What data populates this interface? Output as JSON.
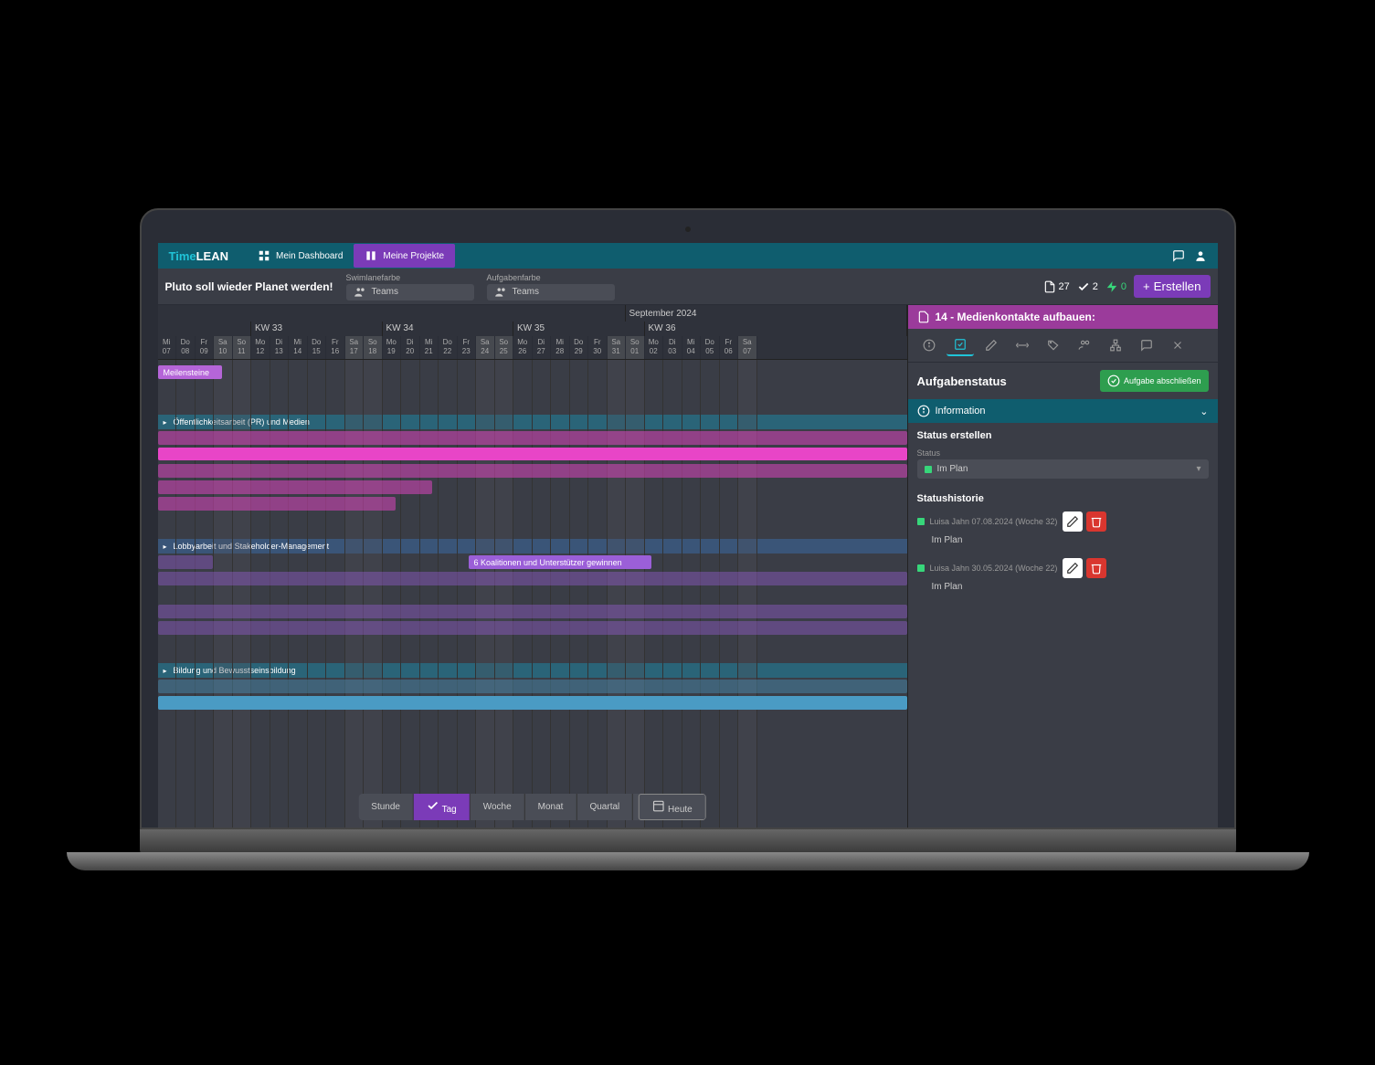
{
  "brand": {
    "part1": "Time",
    "part2": "LEAN"
  },
  "nav": {
    "dashboard": "Mein Dashboard",
    "projects": "Meine Projekte"
  },
  "project_title": "Pluto soll wieder Planet werden!",
  "swimlane": {
    "label": "Swimlanefarbe",
    "value": "Teams"
  },
  "taskcolor": {
    "label": "Aufgabenfarbe",
    "value": "Teams"
  },
  "stats": {
    "files": "27",
    "checks": "2",
    "bolt": "0"
  },
  "btn_create": "Erstellen",
  "month": "September 2024",
  "weeks": [
    "KW 33",
    "KW 34",
    "KW 35",
    "KW 36"
  ],
  "days": [
    {
      "d": "Mi",
      "n": "07"
    },
    {
      "d": "Do",
      "n": "08"
    },
    {
      "d": "Fr",
      "n": "09"
    },
    {
      "d": "Sa",
      "n": "10",
      "we": true
    },
    {
      "d": "So",
      "n": "11",
      "we": true
    },
    {
      "d": "Mo",
      "n": "12"
    },
    {
      "d": "Di",
      "n": "13"
    },
    {
      "d": "Mi",
      "n": "14"
    },
    {
      "d": "Do",
      "n": "15"
    },
    {
      "d": "Fr",
      "n": "16"
    },
    {
      "d": "Sa",
      "n": "17",
      "we": true
    },
    {
      "d": "So",
      "n": "18",
      "we": true
    },
    {
      "d": "Mo",
      "n": "19"
    },
    {
      "d": "Di",
      "n": "20"
    },
    {
      "d": "Mi",
      "n": "21"
    },
    {
      "d": "Do",
      "n": "22"
    },
    {
      "d": "Fr",
      "n": "23"
    },
    {
      "d": "Sa",
      "n": "24",
      "we": true
    },
    {
      "d": "So",
      "n": "25",
      "we": true
    },
    {
      "d": "Mo",
      "n": "26"
    },
    {
      "d": "Di",
      "n": "27"
    },
    {
      "d": "Mi",
      "n": "28"
    },
    {
      "d": "Do",
      "n": "29"
    },
    {
      "d": "Fr",
      "n": "30"
    },
    {
      "d": "Sa",
      "n": "31",
      "we": true
    },
    {
      "d": "So",
      "n": "01",
      "we": true
    },
    {
      "d": "Mo",
      "n": "02"
    },
    {
      "d": "Di",
      "n": "03"
    },
    {
      "d": "Mi",
      "n": "04"
    },
    {
      "d": "Do",
      "n": "05"
    },
    {
      "d": "Fr",
      "n": "06"
    },
    {
      "d": "Sa",
      "n": "07",
      "we": true
    }
  ],
  "groups": {
    "g0": "Meilensteine",
    "g1": "Öffentlichkeitsarbeit (PR) und Medien",
    "g2": "Lobbyarbeit und Stakeholder-Management",
    "g3": "Bildung und Bewusstseinsbildung"
  },
  "tasks": {
    "coalition": "6 Koalitionen und Unterstützer gewinnen"
  },
  "views": {
    "hour": "Stunde",
    "day": "Tag",
    "week": "Woche",
    "month": "Monat",
    "quarter": "Quartal",
    "today": "Heute"
  },
  "panel": {
    "header": "14 - Medienkontakte aufbauen:",
    "status_title": "Aufgabenstatus",
    "btn_complete": "Aufgabe abschließen",
    "info": "Information",
    "create_status": "Status erstellen",
    "status_label": "Status",
    "status_value": "Im Plan",
    "history_title": "Statushistorie",
    "history": [
      {
        "author": "Luisa Jahn 07.08.2024 (Woche 32)",
        "status": "Im Plan"
      },
      {
        "author": "Luisa Jahn 30.05.2024 (Woche 22)",
        "status": "Im Plan"
      }
    ]
  }
}
